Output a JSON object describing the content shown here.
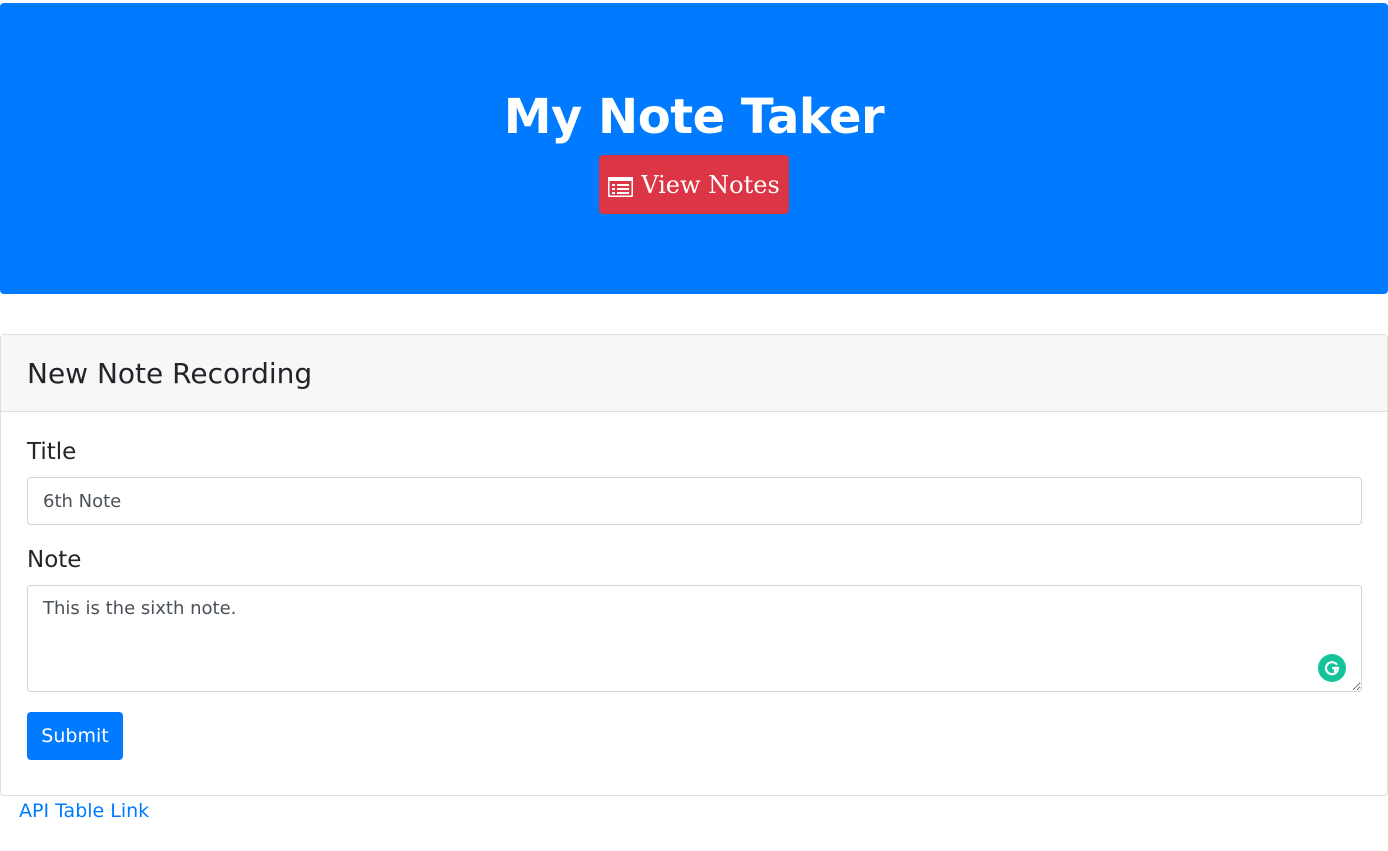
{
  "header": {
    "title": "My Note Taker",
    "view_notes_label": "View Notes",
    "view_notes_icon": "list-icon",
    "background_color": "#007bff",
    "button_color": "#dc3545"
  },
  "form": {
    "heading": "New Note Recording",
    "title_label": "Title",
    "title_value": "6th Note",
    "note_label": "Note",
    "note_value": "This is the sixth note.",
    "submit_label": "Submit",
    "grammarly_icon": "grammarly-icon"
  },
  "footer": {
    "api_link_label": "API Table Link"
  }
}
